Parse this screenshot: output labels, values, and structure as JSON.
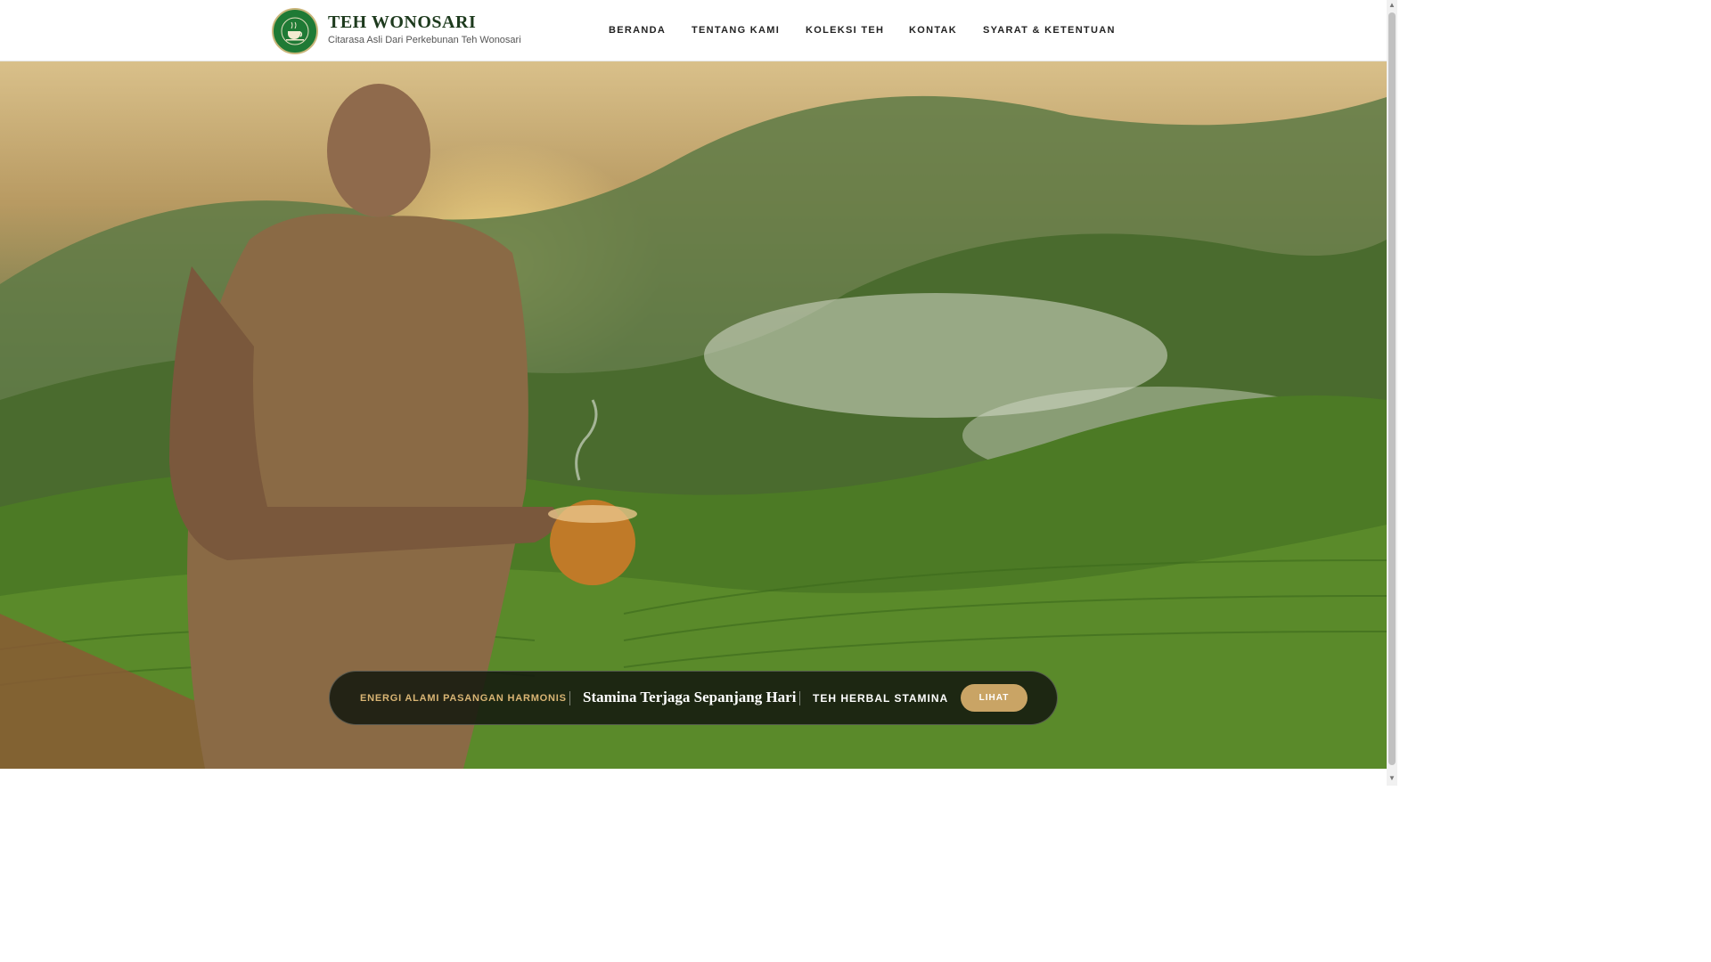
{
  "brand": {
    "title": "TEH WONOSARI",
    "subtitle": "Citarasa Asli Dari Perkebunan Teh Wonosari",
    "logo_text": "TEH WONOSARI",
    "logo_icon": "tea-cup-icon"
  },
  "nav": {
    "items": [
      {
        "label": "BERANDA"
      },
      {
        "label": "TENTANG KAMI"
      },
      {
        "label": "KOLEKSI TEH"
      },
      {
        "label": "KONTAK"
      },
      {
        "label": "SYARAT & KETENTUAN"
      }
    ]
  },
  "hero": {
    "image": "man-holding-tea-cup-on-tea-plantation-photo",
    "tag": "ENERGI ALAMI PASANGAN HARMONIS",
    "headline": "Stamina Terjaga Sepanjang Hari",
    "product": "TEH HERBAL STAMINA",
    "cta_label": "LIHAT"
  },
  "colors": {
    "brand_green": "#1f7a35",
    "accent_gold": "#c9a465",
    "tag_gold": "#d9b574",
    "banner_bg": "#14190f"
  }
}
